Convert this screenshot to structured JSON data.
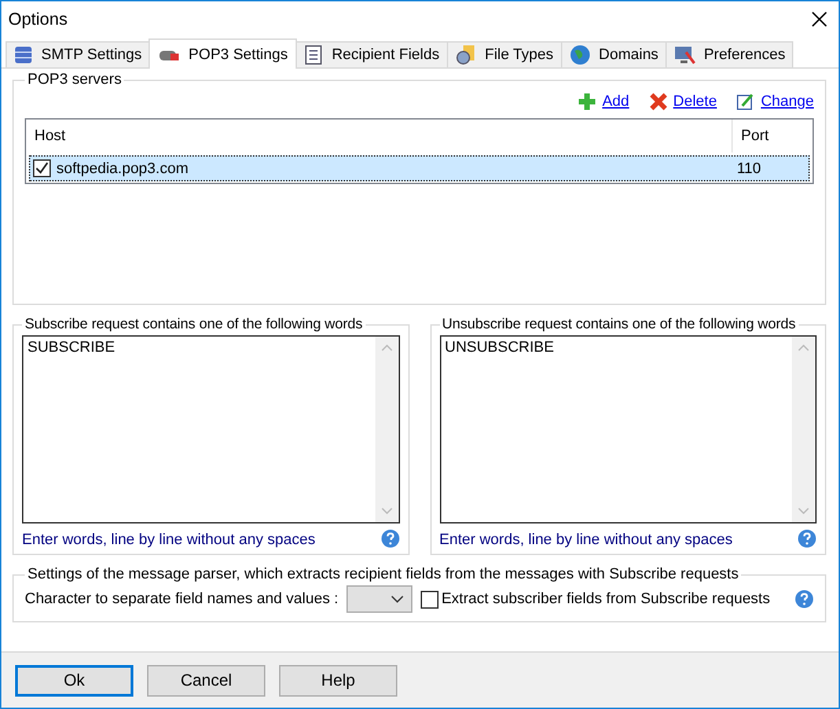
{
  "window": {
    "title": "Options"
  },
  "tabs": [
    {
      "label": "SMTP Settings",
      "selected": false
    },
    {
      "label": "POP3 Settings",
      "selected": true
    },
    {
      "label": "Recipient Fields",
      "selected": false
    },
    {
      "label": "File Types",
      "selected": false
    },
    {
      "label": "Domains",
      "selected": false
    },
    {
      "label": "Preferences",
      "selected": false
    }
  ],
  "pop3_servers": {
    "title": "POP3 servers",
    "actions": [
      "Add",
      "Delete",
      "Change"
    ],
    "columns": [
      "Host",
      "Port"
    ],
    "rows": [
      {
        "host": "softpedia.pop3.com",
        "port": "110",
        "checked": true,
        "selected": true
      }
    ]
  },
  "subscribe": {
    "title": "Subscribe request contains one of the following words",
    "value": "SUBSCRIBE",
    "hint": "Enter words, line by line without any spaces"
  },
  "unsubscribe": {
    "title": "Unsubscribe request contains one of the following words",
    "value": "UNSUBSCRIBE",
    "hint": "Enter words, line by line without any spaces"
  },
  "parser": {
    "title": "Settings of the message parser, which extracts recipient fields from the messages with Subscribe requests",
    "separator_label": "Character to separate field names and values :",
    "extract_label": "Extract subscriber fields from Subscribe requests",
    "extract_checked": false
  },
  "buttons": [
    {
      "label": "Ok",
      "focused": true
    },
    {
      "label": "Cancel",
      "focused": false
    },
    {
      "label": "Help",
      "focused": false
    }
  ]
}
